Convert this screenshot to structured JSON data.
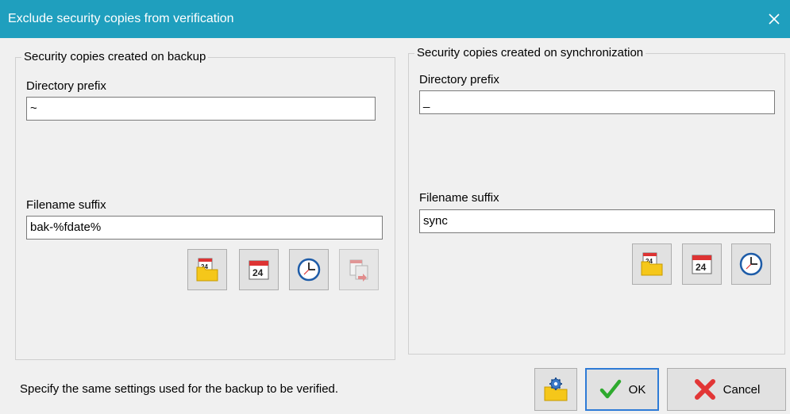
{
  "window": {
    "title": "Exclude security copies from verification"
  },
  "backup_group": {
    "legend": "Security copies created on backup",
    "directory_prefix_label": "Directory prefix",
    "directory_prefix_value": "~",
    "filename_suffix_label": "Filename suffix",
    "filename_suffix_value": "bak-%fdate%"
  },
  "sync_group": {
    "legend": "Security copies created on synchronization",
    "directory_prefix_label": "Directory prefix",
    "directory_prefix_value": "_",
    "filename_suffix_label": "Filename suffix",
    "filename_suffix_value": "sync"
  },
  "status_text": "Specify the same settings used for the backup to be verified.",
  "buttons": {
    "ok_label": "OK",
    "cancel_label": "Cancel"
  },
  "icons": {
    "close": "close-icon",
    "folder_date": "folder-date-icon",
    "calendar": "calendar-icon",
    "clock": "clock-icon",
    "copy_date": "copy-date-icon",
    "settings_folder": "settings-folder-icon",
    "check": "check-icon",
    "cancel": "cancel-x-icon"
  },
  "colors": {
    "titlebar": "#1f9fbe",
    "client": "#f0f0f0",
    "default_border": "#2e7bd6"
  }
}
